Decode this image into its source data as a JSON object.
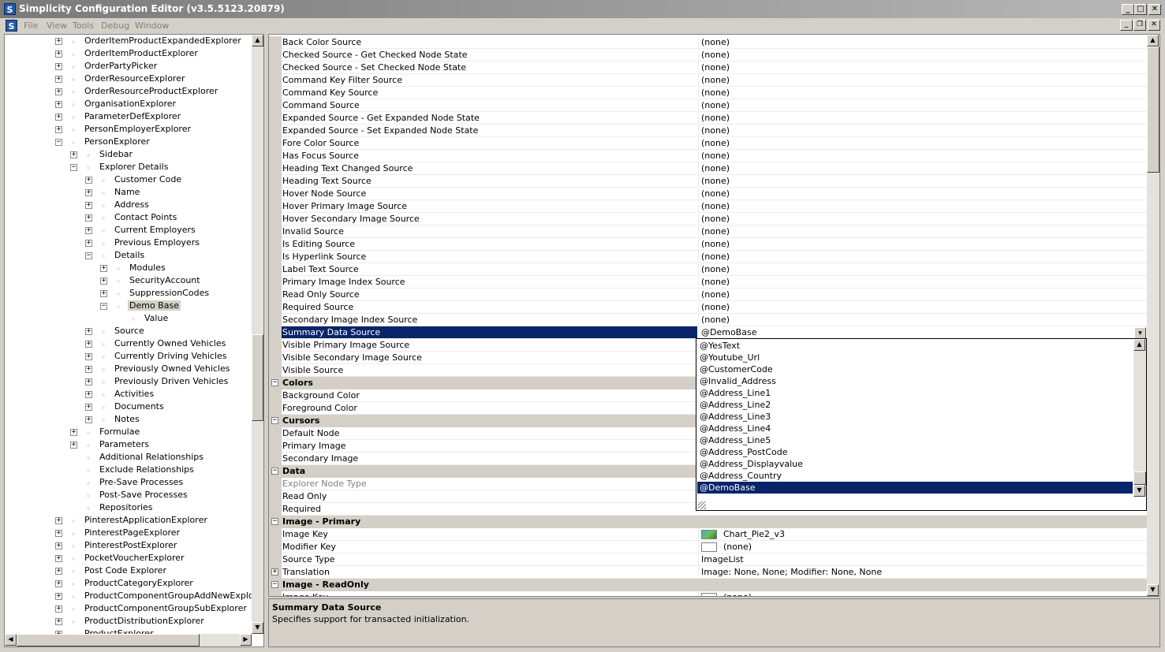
{
  "window": {
    "title": "Simplicity Configuration Editor (v3.5.5123.20879)",
    "app_icon": "S",
    "caption_buttons": [
      "_",
      "□",
      "✕"
    ]
  },
  "menubar": {
    "app_icon": "S",
    "items": [
      "File",
      "View",
      "Tools",
      "Debug",
      "Window"
    ],
    "mdi_buttons": [
      "_",
      "❐",
      "✕"
    ]
  },
  "tree": {
    "nodes": [
      {
        "label": "OrderItemProductExpandedExplorer",
        "level": 0,
        "expander": "+"
      },
      {
        "label": "OrderItemProductExplorer",
        "level": 0,
        "expander": "+"
      },
      {
        "label": "OrderPartyPicker",
        "level": 0,
        "expander": "+"
      },
      {
        "label": "OrderResourceExplorer",
        "level": 0,
        "expander": "+"
      },
      {
        "label": "OrderResourceProductExplorer",
        "level": 0,
        "expander": "+"
      },
      {
        "label": "OrganisationExplorer",
        "level": 0,
        "expander": "+"
      },
      {
        "label": "ParameterDefExplorer",
        "level": 0,
        "expander": "+"
      },
      {
        "label": "PersonEmployerExplorer",
        "level": 0,
        "expander": "+"
      },
      {
        "label": "PersonExplorer",
        "level": 0,
        "expander": "−"
      },
      {
        "label": "Sidebar",
        "level": 1,
        "expander": "+"
      },
      {
        "label": "Explorer Details",
        "level": 1,
        "expander": "−"
      },
      {
        "label": "Customer Code",
        "level": 2,
        "expander": "+"
      },
      {
        "label": "Name",
        "level": 2,
        "expander": "+"
      },
      {
        "label": "Address",
        "level": 2,
        "expander": "+"
      },
      {
        "label": "Contact Points",
        "level": 2,
        "expander": "+"
      },
      {
        "label": "Current Employers",
        "level": 2,
        "expander": "+"
      },
      {
        "label": "Previous Employers",
        "level": 2,
        "expander": "+"
      },
      {
        "label": "Details",
        "level": 2,
        "expander": "−"
      },
      {
        "label": "Modules",
        "level": 3,
        "expander": "+"
      },
      {
        "label": "SecurityAccount",
        "level": 3,
        "expander": "+"
      },
      {
        "label": "SuppressionCodes",
        "level": 3,
        "expander": "+"
      },
      {
        "label": "Demo Base",
        "level": 3,
        "expander": "−",
        "selected": true
      },
      {
        "label": "Value",
        "level": 4,
        "expander": ""
      },
      {
        "label": "Source",
        "level": 2,
        "expander": "+"
      },
      {
        "label": "Currently Owned Vehicles",
        "level": 2,
        "expander": "+"
      },
      {
        "label": "Currently Driving Vehicles",
        "level": 2,
        "expander": "+"
      },
      {
        "label": "Previously Owned Vehicles",
        "level": 2,
        "expander": "+"
      },
      {
        "label": "Previously Driven Vehicles",
        "level": 2,
        "expander": "+"
      },
      {
        "label": "Activities",
        "level": 2,
        "expander": "+"
      },
      {
        "label": "Documents",
        "level": 2,
        "expander": "+"
      },
      {
        "label": "Notes",
        "level": 2,
        "expander": "+"
      },
      {
        "label": "Formulae",
        "level": 1,
        "expander": "+"
      },
      {
        "label": "Parameters",
        "level": 1,
        "expander": "+"
      },
      {
        "label": "Additional Relationships",
        "level": 1,
        "expander": ""
      },
      {
        "label": "Exclude Relationships",
        "level": 1,
        "expander": ""
      },
      {
        "label": "Pre-Save Processes",
        "level": 1,
        "expander": ""
      },
      {
        "label": "Post-Save Processes",
        "level": 1,
        "expander": ""
      },
      {
        "label": "Repositories",
        "level": 1,
        "expander": ""
      },
      {
        "label": "PinterestApplicationExplorer",
        "level": 0,
        "expander": "+"
      },
      {
        "label": "PinterestPageExplorer",
        "level": 0,
        "expander": "+"
      },
      {
        "label": "PinterestPostExplorer",
        "level": 0,
        "expander": "+"
      },
      {
        "label": "PocketVoucherExplorer",
        "level": 0,
        "expander": "+"
      },
      {
        "label": "Post Code Explorer",
        "level": 0,
        "expander": "+"
      },
      {
        "label": "ProductCategoryExplorer",
        "level": 0,
        "expander": "+"
      },
      {
        "label": "ProductComponentGroupAddNewExplorer",
        "level": 0,
        "expander": "+"
      },
      {
        "label": "ProductComponentGroupSubExplorer",
        "level": 0,
        "expander": "+"
      },
      {
        "label": "ProductDistributionExplorer",
        "level": 0,
        "expander": "+"
      },
      {
        "label": "ProductExplorer",
        "level": 0,
        "expander": "+"
      }
    ],
    "scroll_up": "▲",
    "scroll_down": "▼",
    "scroll_left": "◀",
    "scroll_right": "▶"
  },
  "grid": {
    "rows": [
      {
        "kind": "prop",
        "name": "Back Color Source",
        "value": "(none)"
      },
      {
        "kind": "prop",
        "name": "Checked Source - Get Checked Node State",
        "value": "(none)"
      },
      {
        "kind": "prop",
        "name": "Checked Source - Set Checked Node State",
        "value": "(none)"
      },
      {
        "kind": "prop",
        "name": "Command Key Filter Source",
        "value": "(none)"
      },
      {
        "kind": "prop",
        "name": "Command Key Source",
        "value": "(none)"
      },
      {
        "kind": "prop",
        "name": "Command Source",
        "value": "(none)"
      },
      {
        "kind": "prop",
        "name": "Expanded Source - Get Expanded Node State",
        "value": "(none)"
      },
      {
        "kind": "prop",
        "name": "Expanded Source - Set Expanded Node State",
        "value": "(none)"
      },
      {
        "kind": "prop",
        "name": "Fore Color Source",
        "value": "(none)"
      },
      {
        "kind": "prop",
        "name": "Has Focus Source",
        "value": "(none)"
      },
      {
        "kind": "prop",
        "name": "Heading Text Changed Source",
        "value": "(none)"
      },
      {
        "kind": "prop",
        "name": "Heading Text Source",
        "value": "(none)"
      },
      {
        "kind": "prop",
        "name": "Hover Node Source",
        "value": "(none)"
      },
      {
        "kind": "prop",
        "name": "Hover Primary Image Source",
        "value": "(none)"
      },
      {
        "kind": "prop",
        "name": "Hover Secondary Image Source",
        "value": "(none)"
      },
      {
        "kind": "prop",
        "name": "Invalid Source",
        "value": "(none)"
      },
      {
        "kind": "prop",
        "name": "Is Editing Source",
        "value": "(none)"
      },
      {
        "kind": "prop",
        "name": "Is Hyperlink Source",
        "value": "(none)"
      },
      {
        "kind": "prop",
        "name": "Label Text Source",
        "value": "(none)"
      },
      {
        "kind": "prop",
        "name": "Primary Image Index Source",
        "value": "(none)"
      },
      {
        "kind": "prop",
        "name": "Read Only Source",
        "value": "(none)"
      },
      {
        "kind": "prop",
        "name": "Required Source",
        "value": "(none)"
      },
      {
        "kind": "prop",
        "name": "Secondary Image Index Source",
        "value": "(none)"
      },
      {
        "kind": "prop",
        "name": "Summary Data Source",
        "value": "@DemoBase",
        "selected": true
      },
      {
        "kind": "prop",
        "name": "Visible Primary Image Source",
        "value": ""
      },
      {
        "kind": "prop",
        "name": "Visible Secondary Image Source",
        "value": ""
      },
      {
        "kind": "prop",
        "name": "Visible Source",
        "value": ""
      },
      {
        "kind": "cat",
        "name": "Colors"
      },
      {
        "kind": "prop",
        "name": "Background Color",
        "value": ""
      },
      {
        "kind": "prop",
        "name": "Foreground Color",
        "value": ""
      },
      {
        "kind": "cat",
        "name": "Cursors"
      },
      {
        "kind": "prop",
        "name": "Default Node",
        "value": ""
      },
      {
        "kind": "prop",
        "name": "Primary Image",
        "value": ""
      },
      {
        "kind": "prop",
        "name": "Secondary Image",
        "value": ""
      },
      {
        "kind": "cat",
        "name": "Data"
      },
      {
        "kind": "prop",
        "name": "Explorer Node Type",
        "value": "",
        "disabled": true
      },
      {
        "kind": "prop",
        "name": "Read Only",
        "value": ""
      },
      {
        "kind": "prop",
        "name": "Required",
        "value": ""
      },
      {
        "kind": "cat",
        "name": "Image - Primary"
      },
      {
        "kind": "prop",
        "name": "Image Key",
        "value": "Chart_Pie2_v3",
        "swatch": "image"
      },
      {
        "kind": "prop",
        "name": "Modifier Key",
        "value": "(none)",
        "swatch": "blank"
      },
      {
        "kind": "prop",
        "name": "Source Type",
        "value": "ImageList"
      },
      {
        "kind": "prop",
        "name": "Translation",
        "value": "Image: None, None; Modifier: None, None",
        "expander": "+"
      },
      {
        "kind": "cat",
        "name": "Image - ReadOnly"
      },
      {
        "kind": "prop",
        "name": "Image Key",
        "value": "(none)",
        "swatch": "blank"
      }
    ],
    "dropdown_arrow": "▾",
    "scroll_up": "▲",
    "scroll_down": "▼"
  },
  "dropdown": {
    "items": [
      "@YesText",
      "@Youtube_Url",
      "@CustomerCode",
      "@Invalid_Address",
      "@Address_Line1",
      "@Address_Line2",
      "@Address_Line3",
      "@Address_Line4",
      "@Address_Line5",
      "@Address_PostCode",
      "@Address_Displayvalue",
      "@Address_Country",
      "@DemoBase"
    ],
    "selected": "@DemoBase",
    "scroll_up": "▲",
    "scroll_down": "▼"
  },
  "description": {
    "title": "Summary Data Source",
    "text": "Specifies support for transacted initialization."
  },
  "colors": {
    "selection": "#0a246a",
    "face": "#d4d0c8"
  }
}
